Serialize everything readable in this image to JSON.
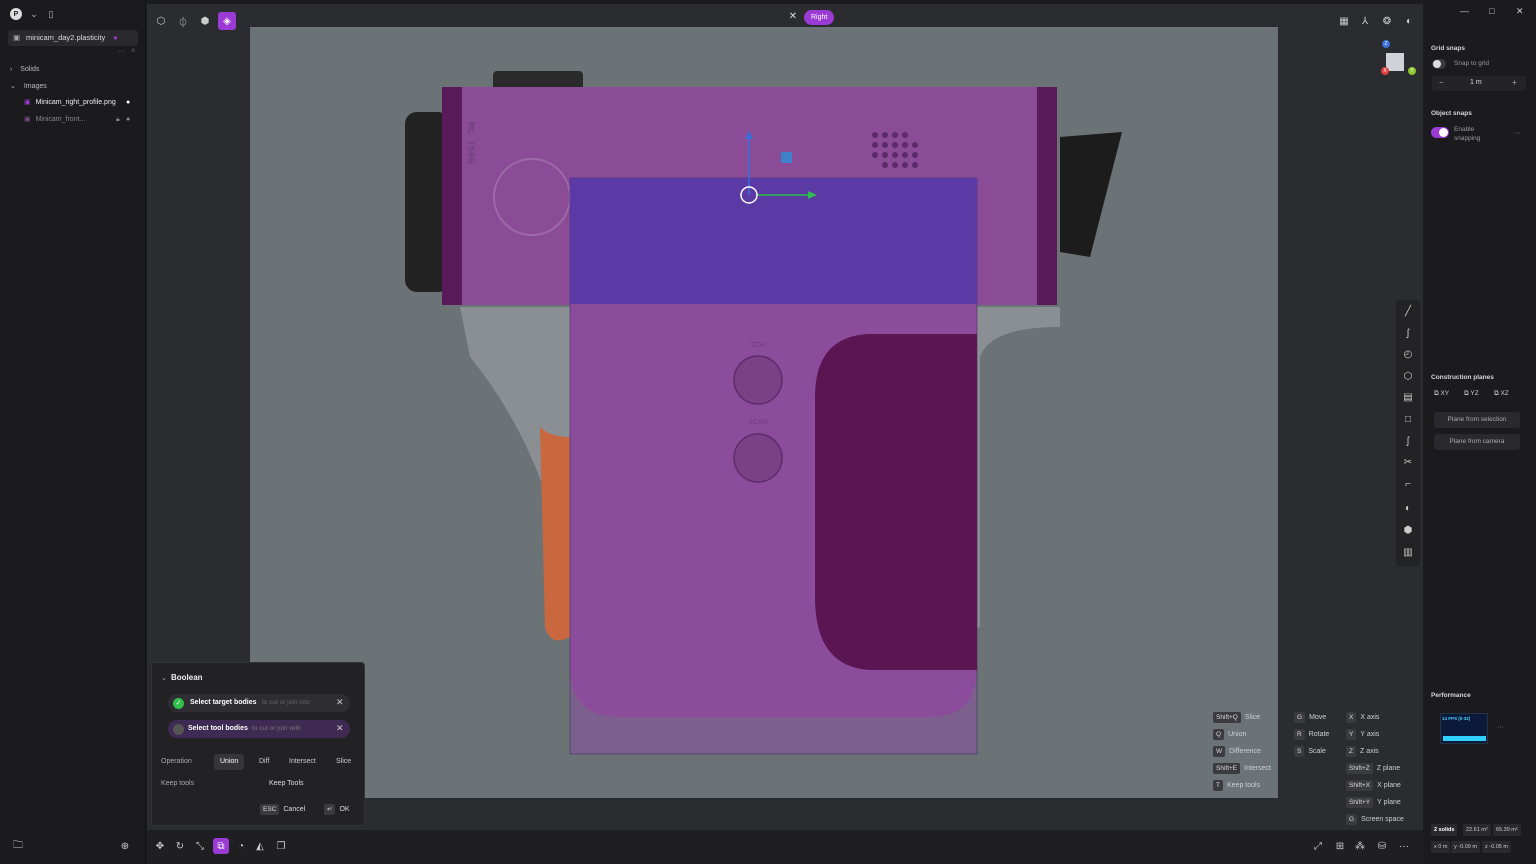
{
  "app": {
    "file_name": "minicam_day2.plasticity"
  },
  "outliner": {
    "groups": [
      {
        "label": "Solids"
      },
      {
        "label": "Images"
      }
    ],
    "images": [
      {
        "label": "Minicam_right_profile.png"
      },
      {
        "label": "Minicam_front..."
      }
    ]
  },
  "view": {
    "name": "Right"
  },
  "scene_labels": {
    "label1": "MC T500",
    "label2": "SZH",
    "label3": "SCAN"
  },
  "right_panel": {
    "grid_snaps_title": "Grid snaps",
    "snap_to_grid_label": "Snap to grid",
    "grid_size": "1 m",
    "object_snaps_title": "Object snaps",
    "enable_snapping_label": "Enable snapping",
    "construction_planes_title": "Construction planes",
    "planes": [
      "XY",
      "YZ",
      "XZ"
    ],
    "plane_from_selection": "Plane from selection",
    "plane_from_camera": "Plane from camera",
    "performance_title": "Performance",
    "fps_label": "14 FPS (0-32)"
  },
  "boolean": {
    "title": "Boolean",
    "target_label": "Select target bodies",
    "target_hint": "to cut or join into",
    "tool_label": "Select tool bodies",
    "tool_hint": "to cut or join with",
    "operation_label": "Operation",
    "operations": [
      "Union",
      "Diff",
      "Intersect",
      "Slice"
    ],
    "selected_operation": "Union",
    "keep_tools_label": "Keep tools",
    "keep_tools_value": "Keep Tools",
    "esc_key": "ESC",
    "cancel_label": "Cancel",
    "ok_label": "OK"
  },
  "shortcuts": {
    "col1": [
      {
        "key": "Shift+Q",
        "label": "Slice"
      },
      {
        "key": "Q",
        "label": "Union"
      },
      {
        "key": "W",
        "label": "Difference"
      },
      {
        "key": "Shift+E",
        "label": "Intersect"
      },
      {
        "key": "T",
        "label": "Keep tools"
      }
    ],
    "col2": [
      {
        "key": "G",
        "label": "Move"
      },
      {
        "key": "R",
        "label": "Rotate"
      },
      {
        "key": "S",
        "label": "Scale"
      }
    ],
    "col3": [
      {
        "key": "X",
        "label": "X axis"
      },
      {
        "key": "Y",
        "label": "Y axis"
      },
      {
        "key": "Z",
        "label": "Z axis"
      },
      {
        "key": "Shift+Z",
        "label": "Z plane"
      },
      {
        "key": "Shift+X",
        "label": "X plane"
      },
      {
        "key": "Shift+Y",
        "label": "Y plane"
      },
      {
        "key": "G",
        "label": "Screen space"
      }
    ]
  },
  "stats": {
    "solids": "2 solids",
    "area1": "22.61 m²",
    "area2": "65.39 m²",
    "x": "x 0 m",
    "y": "y -0.09 m",
    "z": "z -0.05 m"
  },
  "colors": {
    "accent": "#9b3bd6",
    "selection_fill": "#9c56a8",
    "tool_fill": "#5b3aa6",
    "grip_dark": "#5a1552",
    "success": "#2fbf4a"
  }
}
